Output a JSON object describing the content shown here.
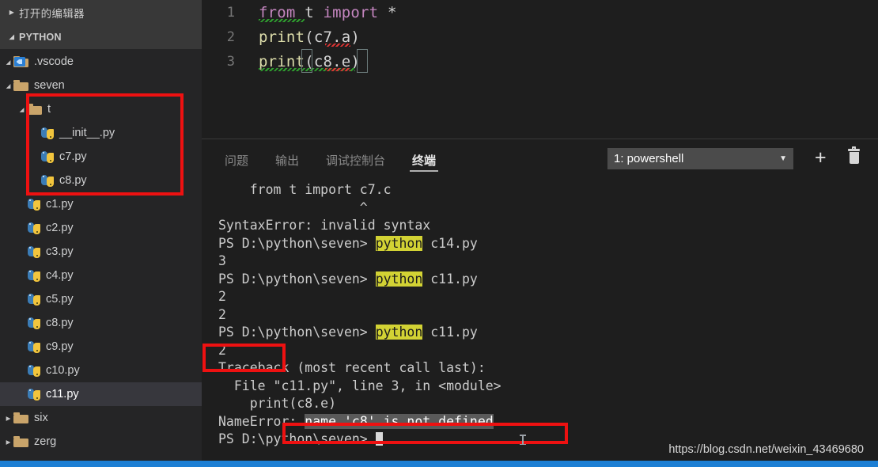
{
  "sidebar": {
    "open_editors_label": "打开的编辑器",
    "open_editors_twisty": "▶",
    "section_label": "PYTHON",
    "section_twisty": "◢",
    "tree": [
      {
        "label": ".vscode",
        "type": "folder-vscode",
        "depth": 1,
        "arrow": "◢"
      },
      {
        "label": "seven",
        "type": "folder",
        "depth": 1,
        "arrow": "◢"
      },
      {
        "label": "t",
        "type": "folder",
        "depth": 2,
        "arrow": "◢"
      },
      {
        "label": "__init__.py",
        "type": "python",
        "depth": 3,
        "arrow": ""
      },
      {
        "label": "c7.py",
        "type": "python",
        "depth": 3,
        "arrow": ""
      },
      {
        "label": "c8.py",
        "type": "python",
        "depth": 3,
        "arrow": ""
      },
      {
        "label": "c1.py",
        "type": "python",
        "depth": 2,
        "arrow": ""
      },
      {
        "label": "c2.py",
        "type": "python",
        "depth": 2,
        "arrow": ""
      },
      {
        "label": "c3.py",
        "type": "python",
        "depth": 2,
        "arrow": ""
      },
      {
        "label": "c4.py",
        "type": "python",
        "depth": 2,
        "arrow": ""
      },
      {
        "label": "c5.py",
        "type": "python",
        "depth": 2,
        "arrow": ""
      },
      {
        "label": "c8.py",
        "type": "python",
        "depth": 2,
        "arrow": ""
      },
      {
        "label": "c9.py",
        "type": "python",
        "depth": 2,
        "arrow": ""
      },
      {
        "label": "c10.py",
        "type": "python",
        "depth": 2,
        "arrow": ""
      },
      {
        "label": "c11.py",
        "type": "python",
        "depth": 2,
        "arrow": "",
        "selected": true
      },
      {
        "label": "six",
        "type": "folder",
        "depth": 1,
        "arrow": "▶"
      },
      {
        "label": "zerg",
        "type": "folder",
        "depth": 1,
        "arrow": "▶"
      }
    ]
  },
  "editor": {
    "lines": [
      {
        "no": "1",
        "segments": [
          {
            "t": "from",
            "c": "kw"
          },
          {
            "t": " t ",
            "c": "pl"
          },
          {
            "t": "import",
            "c": "kw"
          },
          {
            "t": " *",
            "c": "pl"
          }
        ]
      },
      {
        "no": "2",
        "segments": [
          {
            "t": "print",
            "c": "fn"
          },
          {
            "t": "(c7.a)",
            "c": "pl"
          }
        ]
      },
      {
        "no": "3",
        "segments": [
          {
            "t": "print",
            "c": "fn"
          },
          {
            "t": "(c8.e)",
            "c": "pl"
          }
        ]
      }
    ]
  },
  "panel": {
    "tabs": [
      {
        "label": "问题",
        "active": false
      },
      {
        "label": "输出",
        "active": false
      },
      {
        "label": "调试控制台",
        "active": false
      },
      {
        "label": "终端",
        "active": true
      }
    ],
    "terminal_select": "1: powershell",
    "chevron": "▼",
    "add_label": "+",
    "kill_name": "trash-icon"
  },
  "terminal": {
    "lines": [
      {
        "segments": [
          {
            "t": "    from t import c7.c"
          }
        ]
      },
      {
        "segments": [
          {
            "t": "                  ^"
          }
        ]
      },
      {
        "segments": [
          {
            "t": "SyntaxError: invalid syntax"
          }
        ]
      },
      {
        "segments": [
          {
            "t": "PS D:\\python\\seven> "
          },
          {
            "t": "python",
            "c": "t-hl"
          },
          {
            "t": " c14.py"
          }
        ]
      },
      {
        "segments": [
          {
            "t": "3"
          }
        ]
      },
      {
        "segments": [
          {
            "t": "PS D:\\python\\seven> "
          },
          {
            "t": "python",
            "c": "t-hl"
          },
          {
            "t": " c11.py"
          }
        ]
      },
      {
        "segments": [
          {
            "t": "2"
          }
        ]
      },
      {
        "segments": [
          {
            "t": "2"
          }
        ]
      },
      {
        "segments": [
          {
            "t": "PS D:\\python\\seven> "
          },
          {
            "t": "python",
            "c": "t-hl"
          },
          {
            "t": " c11.py"
          }
        ]
      },
      {
        "segments": [
          {
            "t": "2"
          }
        ]
      },
      {
        "segments": [
          {
            "t": "Traceback (most recent call last):"
          }
        ]
      },
      {
        "segments": [
          {
            "t": "  File \"c11.py\", line 3, in <module>"
          }
        ]
      },
      {
        "segments": [
          {
            "t": "    print(c8.e)"
          }
        ]
      },
      {
        "segments": [
          {
            "t": "NameError: "
          },
          {
            "t": "name 'c8' is not defined",
            "c": "t-sel"
          }
        ]
      },
      {
        "segments": [
          {
            "t": "PS D:\\python\\seven> "
          },
          {
            "t": "",
            "cursor": true
          }
        ]
      }
    ]
  },
  "annotations": {
    "box_color": "#ee1111",
    "boxes": [
      {
        "name": "tree-highlight",
        "target": "t folder and its python files"
      },
      {
        "name": "output-two-highlight",
        "target": "2"
      },
      {
        "name": "nameerror-highlight",
        "target": "name 'c8' is not defined"
      }
    ]
  },
  "watermark": {
    "text": "https://blog.csdn.net/weixin_43469680"
  },
  "statusbar": {
    "color": "#1d7fd4"
  }
}
